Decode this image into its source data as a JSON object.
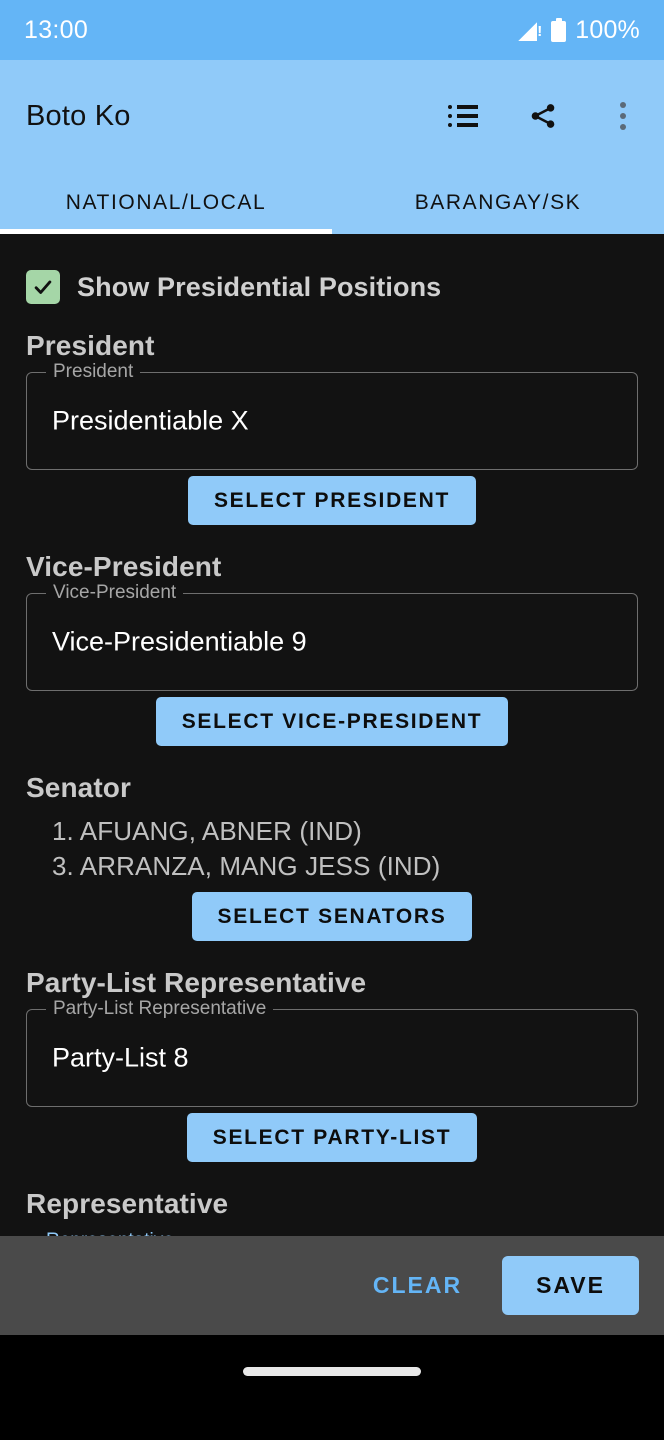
{
  "status_bar": {
    "time": "13:00",
    "battery_percent": "100%",
    "signal_icon": "signal-no-service-icon",
    "battery_icon": "battery-full-icon",
    "background_color": "#64b5f6"
  },
  "app_bar": {
    "title": "Boto Ko",
    "background_color": "#90caf9",
    "actions": [
      {
        "name": "list-view-icon",
        "label": "List"
      },
      {
        "name": "share-icon",
        "label": "Share"
      },
      {
        "name": "overflow-menu-icon",
        "label": "More options"
      }
    ]
  },
  "tabs": {
    "active_index": 0,
    "items": [
      {
        "label": "NATIONAL/LOCAL"
      },
      {
        "label": "BARANGAY/SK"
      }
    ],
    "indicator_color": "#ffffff"
  },
  "form": {
    "show_presidential": {
      "label": "Show Presidential Positions",
      "checked": true,
      "checkbox_color": "#a5d6a7"
    },
    "sections": [
      {
        "heading": "President",
        "field_label": "President",
        "field_value": "Presidentiable X",
        "button_label": "SELECT PRESIDENT"
      },
      {
        "heading": "Vice-President",
        "field_label": "Vice-President",
        "field_value": "Vice-Presidentiable 9",
        "button_label": "SELECT VICE-PRESIDENT"
      },
      {
        "heading": "Senator",
        "list_items": [
          "1. AFUANG, ABNER (IND)",
          "3. ARRANZA, MANG JESS (IND)"
        ],
        "button_label": "SELECT SENATORS"
      },
      {
        "heading": "Party-List Representative",
        "field_label": "Party-List Representative",
        "field_value": "Party-List 8",
        "button_label": "SELECT PARTY-LIST"
      },
      {
        "heading": "Representative",
        "field_label": "Representative"
      }
    ]
  },
  "bottom_bar": {
    "clear_label": "CLEAR",
    "save_label": "SAVE",
    "background_color": "#4a4a4a",
    "clear_color": "#64b5f6",
    "save_color": "#90caf9"
  },
  "nav_bar": {
    "gesture_pill": "gesture-handle"
  }
}
